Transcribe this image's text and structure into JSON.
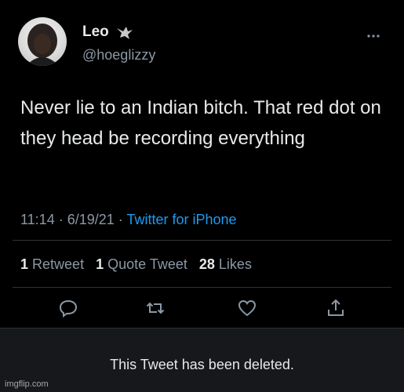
{
  "user": {
    "name": "Leo",
    "name_emoji_icon": "eagle-icon",
    "handle": "@hoeglizzy"
  },
  "tweet": {
    "text": "Never lie to an Indian bitch. That red dot on they head be recording everything",
    "time": "11:14 · 6/19/21 · ",
    "source": "Twitter for iPhone"
  },
  "stats": {
    "retweet_count": "1",
    "retweet_label": "Retweet",
    "quote_count": "1",
    "quote_label": "Quote Tweet",
    "like_count": "28",
    "like_label": "Likes"
  },
  "actions": [
    "reply-icon",
    "retweet-icon",
    "like-icon",
    "share-icon"
  ],
  "more_icon": "more-icon",
  "deleted_notice": "This Tweet has been deleted.",
  "watermark": "imgflip.com",
  "colors": {
    "link": "#1d9bf0",
    "secondary": "#8b98a5",
    "background": "#000000"
  }
}
